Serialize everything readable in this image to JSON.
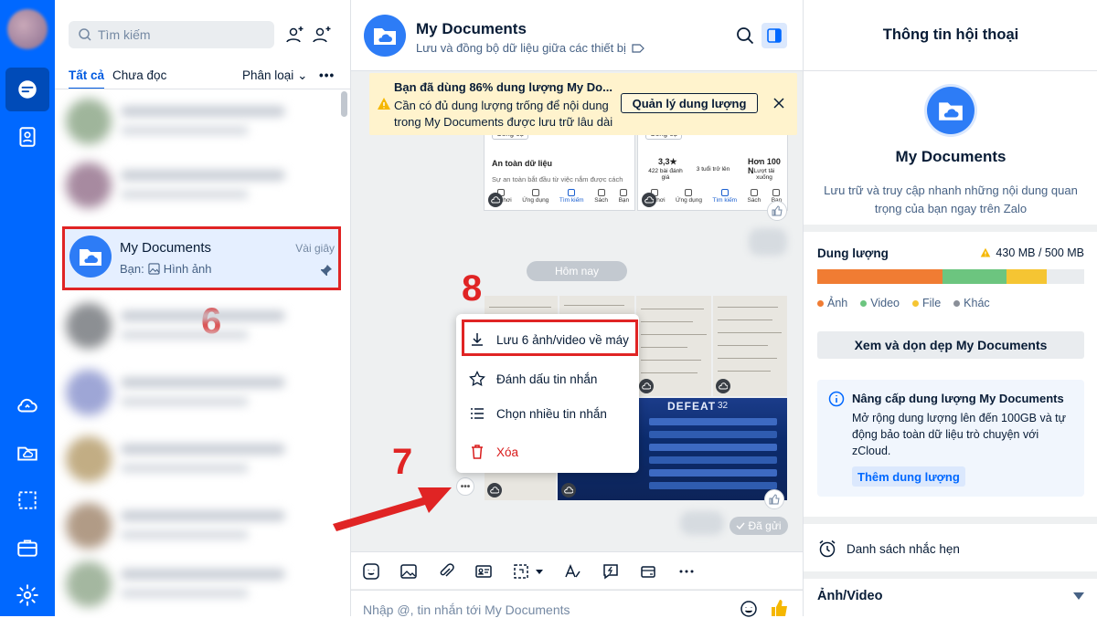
{
  "conv_list": {
    "search_placeholder": "Tìm kiếm",
    "tabs": [
      "Tất cả",
      "Chưa đọc"
    ],
    "classify_label": "Phân loại",
    "more_label": "•••",
    "pinned": {
      "name": "My Documents",
      "time": "Vài giây",
      "sender": "Bạn:",
      "preview": "Hình ảnh"
    }
  },
  "annotations": {
    "step6": "6",
    "step7": "7",
    "step8": "8"
  },
  "chat": {
    "title": "My Documents",
    "subtitle": "Lưu và đồng bộ dữ liệu giữa các thiết bị",
    "warning": {
      "line1": "Bạn đã dùng 86% dung lượng My Do...",
      "line2": "Cần có đủ dung lượng trống để nội dung",
      "line3": "trong My Documents được lưu trữ lâu dài",
      "button": "Quản lý dung lượng"
    },
    "shot_left": {
      "tag": "Công cụ",
      "heading": "An toàn dữ liệu",
      "body": "Sự an toàn bắt đầu từ việc nắm được cách",
      "nav": [
        "Trò chơi",
        "Ứng dụng",
        "Tìm kiếm",
        "Sách",
        "Bạn"
      ]
    },
    "shot_right": {
      "tag": "Công cụ",
      "stat1": "3,3★",
      "stat1_sub": "422 bài đánh giá",
      "stat2": "3 tuổi trở lên",
      "stat3": "Hơn 100 N",
      "stat3_sub": "Lượt tải xuống",
      "nav": [
        "Trò chơi",
        "Ứng dụng",
        "Tìm kiếm",
        "Sách",
        "Bạn"
      ]
    },
    "date_pill": "Hôm nay",
    "game_text": "DEFEAT",
    "game_num": "32",
    "context_menu": [
      {
        "label": "Lưu 6 ảnh/video về máy"
      },
      {
        "label": "Đánh dấu tin nhắn"
      },
      {
        "label": "Chọn nhiều tin nhắn"
      },
      {
        "label": "Xóa"
      }
    ],
    "sent_label": "Đã gửi",
    "composer_placeholder": "Nhập @, tin nhắn tới My Documents"
  },
  "info": {
    "title": "Thông tin hội thoại",
    "name": "My Documents",
    "description": "Lưu trữ và truy cập nhanh những nội dung quan trọng của bạn ngay trên Zalo",
    "storage_label": "Dung lượng",
    "storage_value": "430 MB / 500 MB",
    "storage_breakdown": [
      {
        "name": "Ảnh",
        "fraction": 0.47,
        "color": "#f07c33"
      },
      {
        "name": "Video",
        "fraction": 0.24,
        "color": "#6cc57f"
      },
      {
        "name": "File",
        "fraction": 0.15,
        "color": "#f5c533"
      },
      {
        "name": "Khác",
        "fraction": 0.0,
        "color": "#8a8f98"
      }
    ],
    "clean_button": "Xem và dọn dẹp My Documents",
    "upgrade_title": "Nâng cấp dung lượng My Documents",
    "upgrade_desc": "Mở rộng dung lượng lên đến 100GB và tự động bảo toàn dữ liệu trò chuyện với zCloud.",
    "upgrade_button": "Thêm dung lượng",
    "reminder_label": "Danh sách nhắc hẹn",
    "media_label": "Ảnh/Video"
  },
  "colors": {
    "brand": "#0068ff",
    "annotation_red": "#e02424"
  }
}
